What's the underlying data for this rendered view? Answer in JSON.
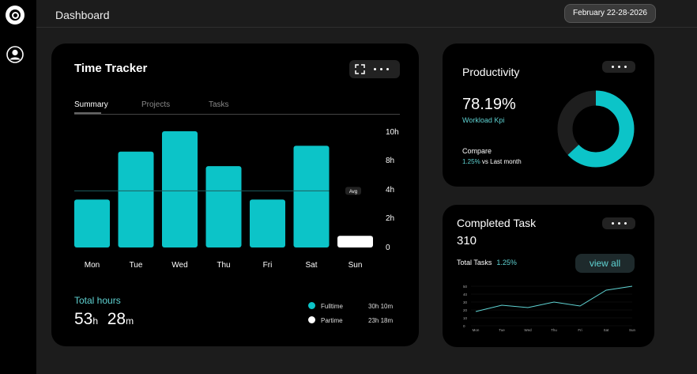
{
  "header": {
    "title": "Dashboard",
    "date_range": "February 22-28-2026"
  },
  "time_tracker": {
    "title": "Time Tracker",
    "tabs": [
      {
        "label": "Summary"
      },
      {
        "label": "Projects"
      },
      {
        "label": "Tasks"
      }
    ],
    "total_hours_label": "Total hours",
    "total_hours_h": "53",
    "total_hours_h_unit": "h",
    "total_hours_m": "28",
    "total_hours_m_unit": "m",
    "legend": [
      {
        "label": "Fulltime",
        "value": "30h 10m",
        "color": "#0cc4c8"
      },
      {
        "label": "Partime",
        "value": "23h 18m",
        "color": "#ffffff"
      }
    ]
  },
  "chart_data": [
    {
      "type": "bar",
      "categories": [
        "Mon",
        "Tue",
        "Wed",
        "Thu",
        "Fri",
        "Sat",
        "Sun"
      ],
      "values": [
        3.3,
        6.6,
        8,
        5.6,
        3.3,
        7,
        0.8
      ],
      "colors": [
        "#0cc4c8",
        "#0cc4c8",
        "#0cc4c8",
        "#0cc4c8",
        "#0cc4c8",
        "#0cc4c8",
        "#ffffff"
      ],
      "yticks": [
        "10h",
        "8h",
        "4h",
        "2h",
        "0"
      ],
      "ylim": [
        0,
        8
      ],
      "average_label": "Avg",
      "average": 3.9
    },
    {
      "type": "line",
      "categories": [
        "Mon",
        "Tue",
        "Wed",
        "Thu",
        "Fri",
        "Sat",
        "Sun"
      ],
      "values": [
        18,
        26,
        23,
        30,
        25,
        45,
        50
      ],
      "yticks": [
        "50",
        "40",
        "30",
        "20",
        "10",
        "0"
      ],
      "ylim": [
        0,
        55
      ],
      "color": "#5fd3d3"
    }
  ],
  "productivity": {
    "title": "Productivity",
    "percent": "78.19%",
    "kpi_label": "Workload Kpi",
    "compare_label": "Compare",
    "compare_value": "1.25%",
    "compare_suffix": " vs Last month",
    "donut_fraction": 0.63,
    "donut_color": "#0cc4c8"
  },
  "completed_task": {
    "title": "Completed Task",
    "count": "310",
    "total_label": "Total Tasks",
    "total_change": "1.25%",
    "view_all_label": "view all"
  }
}
